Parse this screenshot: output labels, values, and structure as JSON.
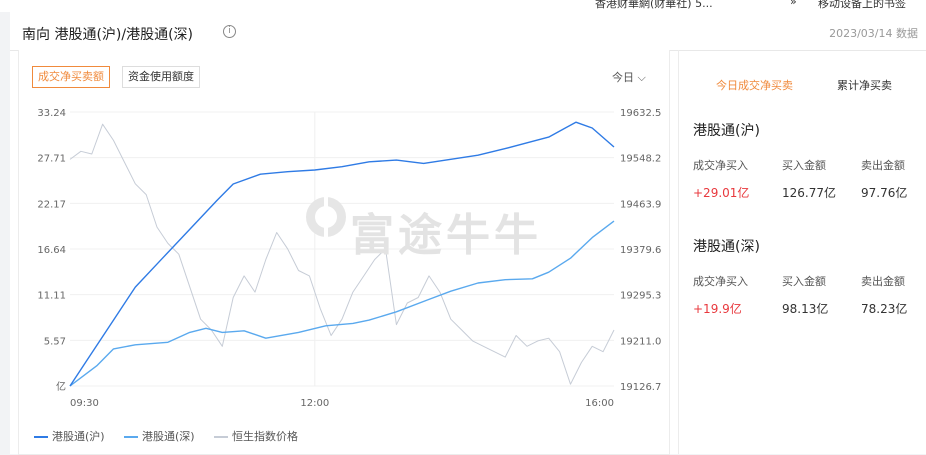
{
  "top_strip": {
    "item1": "香港财華網(财華社) 5...",
    "item2": "»",
    "item3": "移动设备上的书签"
  },
  "header": {
    "title": "南向 港股通(沪)/港股通(深)",
    "info_glyph": "i",
    "date": "2023/03/14 数据"
  },
  "chart_tabs": {
    "tab1": "成交净买卖额",
    "tab2": "资金使用额度",
    "range": "今日 ⌵"
  },
  "watermark": {
    "text": "富途牛牛"
  },
  "legend": {
    "s1": "港股通(沪)",
    "s2": "港股通(深)",
    "s3": "恒生指数价格"
  },
  "side": {
    "tab_active": "今日成交净买卖",
    "tab_other": "累计净买卖",
    "cols": [
      "成交净买入",
      "买入金额",
      "卖出金额"
    ],
    "sh": {
      "title": "港股通(沪)",
      "net": "+29.01亿",
      "buy": "126.77亿",
      "sell": "97.76亿"
    },
    "sz": {
      "title": "港股通(深)",
      "net": "+19.9亿",
      "buy": "98.13亿",
      "sell": "78.23亿"
    }
  },
  "colors": {
    "accent": "#f08a3c",
    "positive": "#e8383d",
    "sh_line": "#2f7be5",
    "sz_line": "#5aa9ee",
    "hsi_line": "#c6ccd6"
  },
  "chart_data": {
    "type": "line",
    "x_ticks": [
      "09:30",
      "12:00",
      "16:00"
    ],
    "left_axis": {
      "unit": "亿",
      "ticks": [
        33.24,
        27.71,
        22.17,
        16.64,
        11.11,
        5.57
      ],
      "range": [
        0,
        33.24
      ]
    },
    "right_axis": {
      "ticks": [
        19632.5,
        19548.2,
        19463.9,
        19379.6,
        19295.3,
        19211.0,
        19126.7
      ],
      "range": [
        19126.7,
        19632.5
      ]
    },
    "series": [
      {
        "name": "港股通(沪)",
        "axis": "left",
        "x": [
          0,
          0.03,
          0.08,
          0.12,
          0.17,
          0.22,
          0.27,
          0.3,
          0.35,
          0.4,
          0.45,
          0.5,
          0.55,
          0.6,
          0.65,
          0.7,
          0.75,
          0.8,
          0.84,
          0.88,
          0.93,
          0.96,
          1.0
        ],
        "y": [
          0,
          3.0,
          8.0,
          12.0,
          15.5,
          19.0,
          22.5,
          24.5,
          25.7,
          26.0,
          26.2,
          26.6,
          27.2,
          27.4,
          27.0,
          27.5,
          28.0,
          28.8,
          29.5,
          30.2,
          32.0,
          31.3,
          29.0
        ]
      },
      {
        "name": "港股通(深)",
        "axis": "left",
        "x": [
          0,
          0.05,
          0.08,
          0.12,
          0.18,
          0.22,
          0.25,
          0.28,
          0.32,
          0.36,
          0.42,
          0.47,
          0.52,
          0.55,
          0.6,
          0.66,
          0.7,
          0.75,
          0.8,
          0.85,
          0.88,
          0.92,
          0.96,
          1.0
        ],
        "y": [
          0,
          2.5,
          4.5,
          5.0,
          5.3,
          6.5,
          7.0,
          6.5,
          6.7,
          5.8,
          6.5,
          7.3,
          7.6,
          8.0,
          9.0,
          10.5,
          11.5,
          12.5,
          12.9,
          13.0,
          13.8,
          15.5,
          18.0,
          20.0
        ]
      },
      {
        "name": "恒生指数价格",
        "axis": "right",
        "x": [
          0,
          0.02,
          0.04,
          0.06,
          0.08,
          0.1,
          0.12,
          0.14,
          0.16,
          0.18,
          0.2,
          0.22,
          0.24,
          0.26,
          0.28,
          0.3,
          0.32,
          0.34,
          0.36,
          0.38,
          0.4,
          0.42,
          0.44,
          0.46,
          0.48,
          0.5,
          0.52,
          0.54,
          0.56,
          0.58,
          0.6,
          0.62,
          0.64,
          0.66,
          0.68,
          0.7,
          0.72,
          0.74,
          0.76,
          0.78,
          0.8,
          0.82,
          0.84,
          0.86,
          0.88,
          0.9,
          0.92,
          0.94,
          0.96,
          0.98,
          1.0
        ],
        "y": [
          19545,
          19560,
          19555,
          19610,
          19580,
          19540,
          19500,
          19480,
          19420,
          19390,
          19370,
          19310,
          19250,
          19230,
          19200,
          19290,
          19330,
          19300,
          19360,
          19410,
          19380,
          19340,
          19330,
          19270,
          19220,
          19250,
          19300,
          19330,
          19360,
          19380,
          19240,
          19280,
          19290,
          19330,
          19300,
          19250,
          19230,
          19210,
          19200,
          19190,
          19180,
          19220,
          19200,
          19210,
          19215,
          19190,
          19130,
          19170,
          19200,
          19190,
          19230
        ]
      }
    ]
  }
}
